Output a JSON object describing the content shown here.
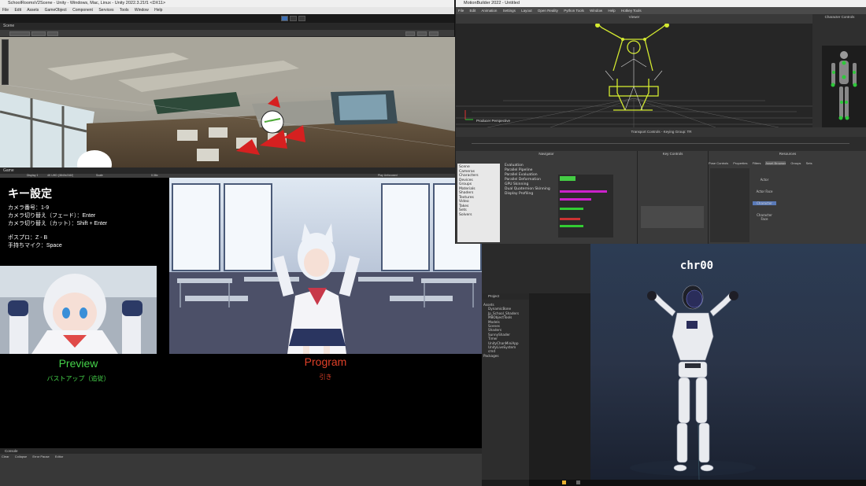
{
  "unity": {
    "title": "SchoolRoomsV2Scene - Unity - Windows, Mac, Linux - Unity 2022.3.21f1 <DX11>",
    "menu": [
      "File",
      "Edit",
      "Assets",
      "GameObject",
      "Component",
      "Services",
      "Tools",
      "Window",
      "Help"
    ],
    "scene_tab": "Scene",
    "game_tab": "Game",
    "game_toolbar": {
      "display": "Display 1",
      "aspect": "4K UHD (3840x2160)",
      "scale": "Scale",
      "scale_value": "0.36x",
      "play_mode": "Play Unfocused"
    },
    "project_tab": "Project",
    "project_items": [
      "Assets",
      "DynamicBone",
      "Jp_School_Shaders",
      "MBObjectTools",
      "Models",
      "Scenes",
      "Shaders",
      "SunnyShader",
      "Timer",
      "UnityChanMiniApp",
      "UnityLiveSystem",
      "cmd",
      "Packages"
    ],
    "console_tab": "Console",
    "console_toolbar": [
      "Clear",
      "Collapse",
      "Error Pause",
      "Editor"
    ]
  },
  "game": {
    "heading": "キー設定",
    "lines": [
      "カメラ番号：1-9",
      "カメラ切り替え（フェード）：Enter",
      "カメラ切り替え（カット）：Shift + Enter",
      "",
      "ポスプロ：Z - B",
      "手持ちマイク：Space"
    ],
    "preview_label": "Preview",
    "preview_sub": "バストアップ（追従）",
    "program_label": "Program",
    "program_sub": "引き",
    "colors": {
      "preview": "#45d34a",
      "program": "#e04028"
    }
  },
  "mb": {
    "title": "MotionBuilder 2022 - Untitled",
    "menu": [
      "File",
      "Edit",
      "Animation",
      "Settings",
      "Layout",
      "Open Reality",
      "Python Tools",
      "Window",
      "Help",
      "Hotkey Tools"
    ],
    "viewer_label": "Viewer",
    "producer_label": "Producer Perspective",
    "transport_label": "Transport Controls - Keying Group: TR",
    "navigator_label": "Navigator",
    "key_controls_label": "Key Controls",
    "resources_label": "Resources",
    "character_controls_label": "Character Controls",
    "resource_tabs": [
      "Pose Controls",
      "Properties",
      "Filters",
      "Asset Browser",
      "Groups",
      "Sets"
    ],
    "resource_items": [
      "Actor",
      "Actor Face",
      "Character",
      "Character Face"
    ],
    "navigator_items": [
      "Scene",
      "Cameras",
      "Characters",
      "Devices",
      "Groups",
      "Materials",
      "Shaders",
      "Textures",
      "Video",
      "Takes",
      "Sets",
      "Solvers"
    ],
    "settings_title": "Evaluation",
    "settings": [
      "Parallel Pipeline",
      "Parallel Evaluation",
      "Parallel Deformation",
      "GPU Skinning",
      "Dual Quaternion Skinning",
      "Display Profiling"
    ],
    "icon_color": "#d4ea30"
  },
  "chr": {
    "name": "chr00"
  }
}
